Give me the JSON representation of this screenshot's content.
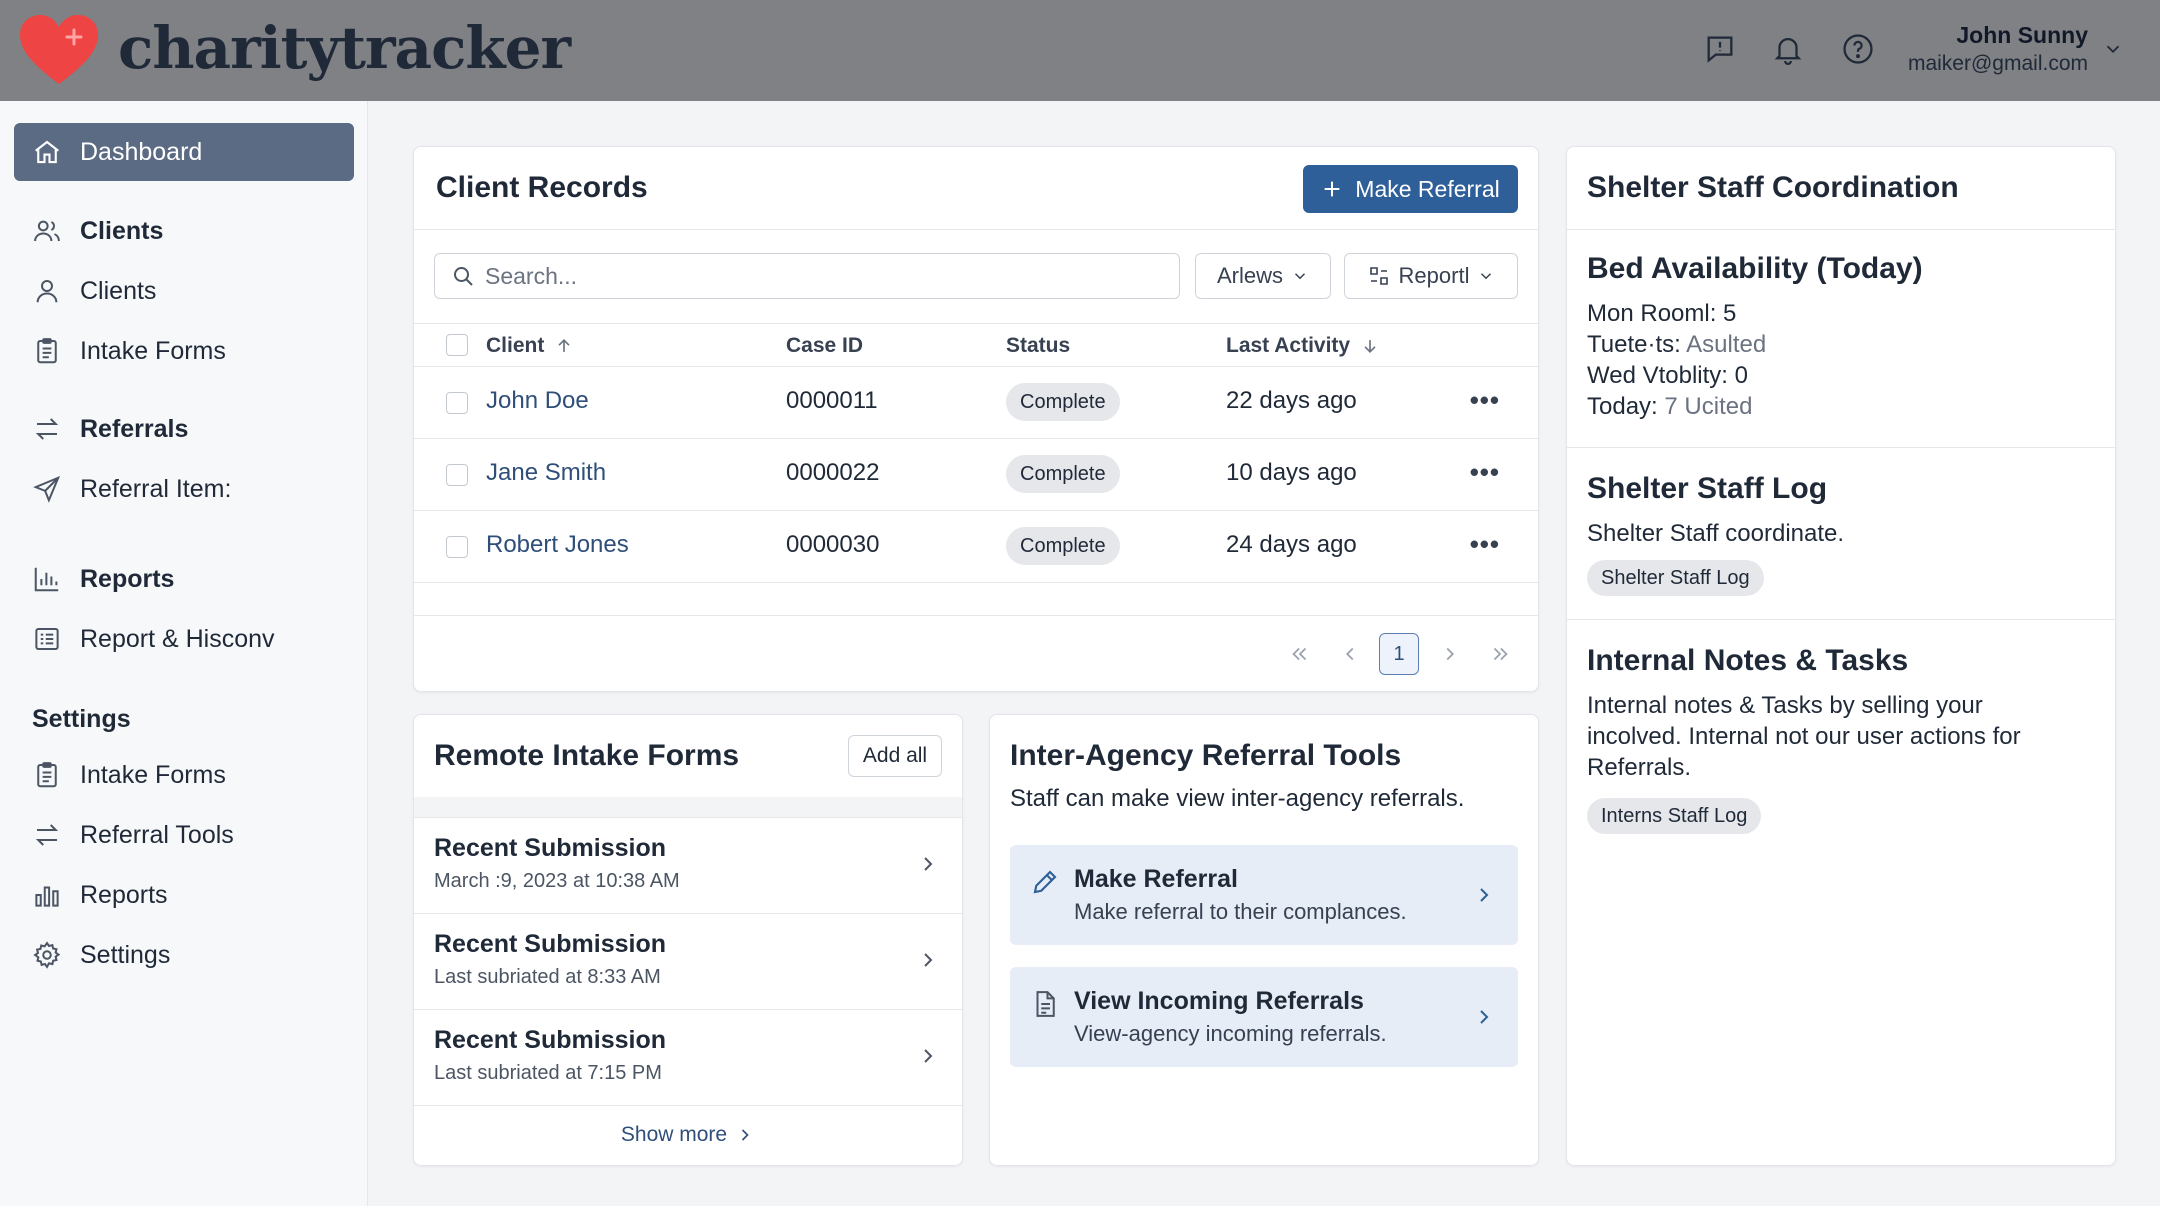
{
  "app": {
    "brand": "charitytracker",
    "user_name": "John Sunny",
    "user_email": "maiker@gmail.com"
  },
  "sidebar": {
    "active": "Dashboard",
    "group1": [
      "Clients",
      "Clients",
      "Intake Forms"
    ],
    "group2": [
      "Referrals",
      "Referral Item:"
    ],
    "group3": [
      "Reports",
      "Report & Hisconv"
    ],
    "settings_heading": "Settings",
    "group4": [
      "Intake Forms",
      "Referral Tools",
      "Reports",
      "Settings"
    ]
  },
  "client_records": {
    "title": "Client Records",
    "make_referral": "Make Referral",
    "search_placeholder": "Search...",
    "filter1": "Arlews",
    "filter2": "Reportl",
    "columns": [
      "Client",
      "Case ID",
      "Status",
      "Last Activity"
    ],
    "rows": [
      {
        "client": "John Doe",
        "case_id": "0000011",
        "status": "Complete",
        "last_activity": "22 days ago"
      },
      {
        "client": "Jane Smith",
        "case_id": "0000022",
        "status": "Complete",
        "last_activity": "10 days ago"
      },
      {
        "client": "Robert Jones",
        "case_id": "0000030",
        "status": "Complete",
        "last_activity": "24 days ago"
      }
    ],
    "page": "1"
  },
  "remote_intake": {
    "title": "Remote Intake Forms",
    "add_all": "Add all",
    "items": [
      {
        "title": "Recent Submission",
        "meta": "March :9, 2023 at 10:38 AM"
      },
      {
        "title": "Recent Submission",
        "meta": "Last subriated at 8:33 AM"
      },
      {
        "title": "Recent Submission",
        "meta": "Last subriated at 7:15 PM"
      }
    ],
    "show_more": "Show more"
  },
  "referral_tools": {
    "title": "Inter-Agency Referral Tools",
    "subtitle": "Staff can make view inter-agency referrals.",
    "tiles": [
      {
        "title": "Make Referral",
        "desc": "Make referral to their complances."
      },
      {
        "title": "View Incoming Referrals",
        "desc": "View-agency incoming referrals."
      }
    ]
  },
  "shelter": {
    "title": "Shelter Staff Coordination",
    "bed_title": "Bed Availability (Today)",
    "bed_lines": [
      {
        "label": "Mon Rooml: 5",
        "value": ""
      },
      {
        "label": "Tuete·ts:",
        "value": "Asulted"
      },
      {
        "label": "Wed Vtoblity: 0",
        "value": ""
      },
      {
        "label": "Today:",
        "value": "7 Ucited"
      }
    ],
    "log_title": "Shelter Staff Log",
    "log_text": "Shelter Staff coordinate.",
    "log_chip": "Shelter Staff Log",
    "notes_title": "Internal Notes & Tasks",
    "notes_text": [
      "Internal notes & Tasks by selling your",
      "incolved. Internal not our user actions for",
      "Referrals."
    ],
    "notes_chip": "Interns Staff Log"
  },
  "colors": {
    "topbar": "#7f8185",
    "primary": "#2f5f98",
    "sidebar_active": "#5b6b83",
    "heart": "#ef4444"
  }
}
